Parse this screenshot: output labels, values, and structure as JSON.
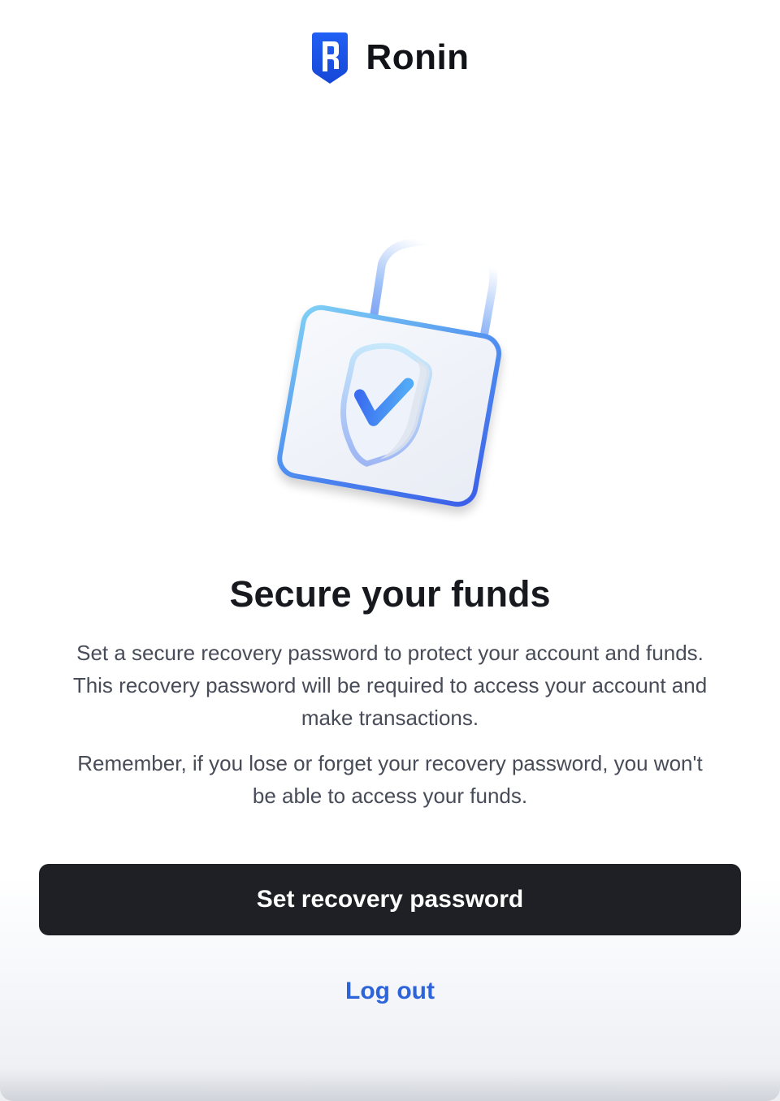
{
  "brand": {
    "name": "Ronin",
    "logo_icon": "ronin-shield-icon",
    "logo_color": "#1e57f0"
  },
  "hero": {
    "icon": "padlock-shield-check-icon",
    "accent": "#3b7bf0"
  },
  "content": {
    "title": "Secure your funds",
    "paragraph_1": "Set a secure recovery password to protect your account and funds. This recovery password will be required to access your account and make transactions.",
    "paragraph_2": "Remember, if you lose or forget your recovery password, you won't be able to access your funds."
  },
  "actions": {
    "primary_label": "Set recovery password",
    "primary_color": "#1f2025",
    "secondary_label": "Log out",
    "secondary_color": "#2d64d9"
  }
}
